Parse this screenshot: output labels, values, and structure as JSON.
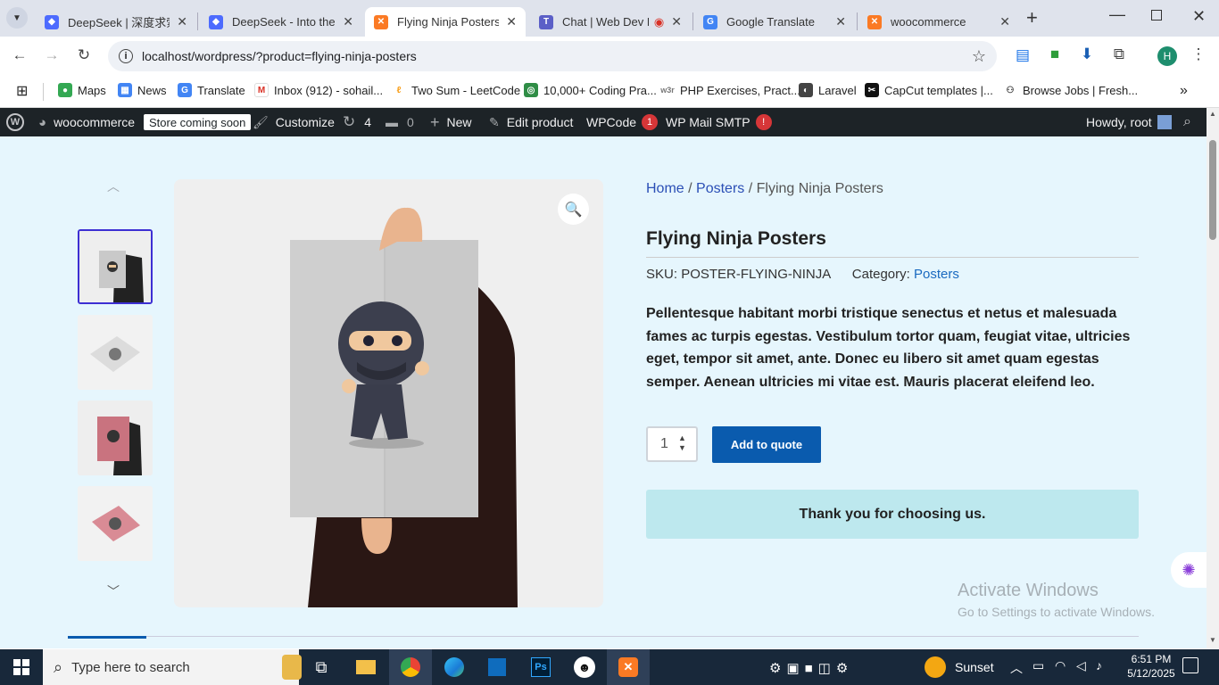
{
  "browser": {
    "tabs": [
      {
        "title": "DeepSeek | 深度求索",
        "active": false
      },
      {
        "title": "DeepSeek - Into the Unknown",
        "active": false
      },
      {
        "title": "Flying Ninja Posters – woocommerce",
        "active": true
      },
      {
        "title": "Chat | Web Dev D",
        "active": false
      },
      {
        "title": "Google Translate",
        "active": false
      },
      {
        "title": "woocommerce",
        "active": false
      }
    ],
    "url": "localhost/wordpress/?product=flying-ninja-posters",
    "profile_initial": "H",
    "bookmarks": [
      "Maps",
      "News",
      "Translate",
      "Inbox (912) - sohail...",
      "Two Sum - LeetCode",
      "10,000+ Coding Pra...",
      "PHP Exercises, Pract...",
      "Laravel",
      "CapCut templates |...",
      "Browse Jobs | Fresh..."
    ]
  },
  "adminbar": {
    "site": "woocommerce",
    "store_status": "Store coming soon",
    "customize": "Customize",
    "updates": "4",
    "comments": "0",
    "new": "New",
    "edit_product": "Edit product",
    "wpcode": "WPCode",
    "wpcode_badge": "1",
    "smtp": "WP Mail SMTP",
    "smtp_badge": "!",
    "howdy": "Howdy, root"
  },
  "product": {
    "breadcrumb_home": "Home",
    "breadcrumb_sep1": " / ",
    "breadcrumb_cat": "Posters",
    "breadcrumb_current": " / Flying Ninja Posters",
    "title": "Flying Ninja Posters",
    "sku_label": "SKU: ",
    "sku": "POSTER-FLYING-NINJA",
    "category_label": "Category: ",
    "category": "Posters",
    "description": "Pellentesque habitant morbi tristique senectus et netus et malesuada fames ac turpis egestas. Vestibulum tortor quam, feugiat vitae, ultricies eget, tempor sit amet, ante. Donec eu libero sit amet quam egestas semper. Aenean ultricies mi vitae est. Mauris placerat eleifend leo.",
    "quantity": "1",
    "add_button": "Add to quote",
    "thanks": "Thank you for choosing us."
  },
  "watermark": {
    "line1": "Activate Windows",
    "line2": "Go to Settings to activate Windows."
  },
  "taskbar": {
    "search_placeholder": "Type here to search",
    "weather": "Sunset",
    "time": "6:51 PM",
    "date": "5/12/2025"
  }
}
